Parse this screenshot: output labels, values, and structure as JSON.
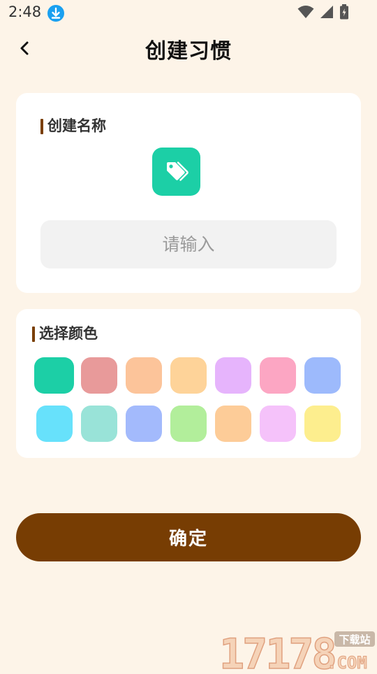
{
  "status_bar": {
    "time": "2:48",
    "icons": [
      "download-icon",
      "wifi-icon",
      "signal-icon",
      "battery-icon"
    ]
  },
  "header": {
    "title": "创建习惯",
    "back_icon": "chevron-left-icon"
  },
  "name_section": {
    "title": "创建名称",
    "icon": "tag-icon",
    "icon_color": "#1ccfa6",
    "input": {
      "value": "",
      "placeholder": "请输入"
    }
  },
  "color_section": {
    "title": "选择颜色",
    "selected_index": 0,
    "colors": [
      "#1ccfa6",
      "#e89a9a",
      "#fcc49a",
      "#fed399",
      "#e6b4fc",
      "#fca6c3",
      "#9dbafc",
      "#67e1fb",
      "#99e3d8",
      "#a3bafc",
      "#b2ee9b",
      "#fdcc98",
      "#f5c2fa",
      "#fdee8e"
    ]
  },
  "confirm_label": "确定",
  "watermark": {
    "number": "17178",
    "domain": ".COM",
    "tag": "下载站"
  },
  "accent_color": "#773d03",
  "background_color": "#fdf4e8"
}
